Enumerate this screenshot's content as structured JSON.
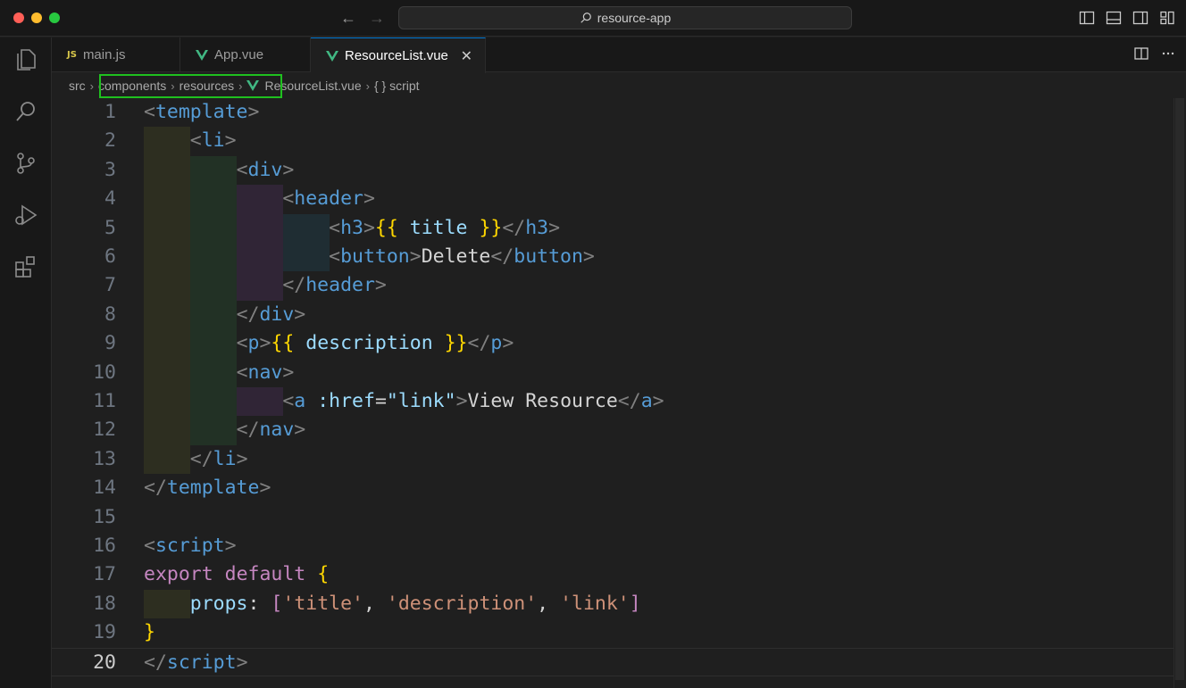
{
  "window": {
    "search_text": "resource-app"
  },
  "tabs": [
    {
      "badge": "JS",
      "label": "main.js",
      "icon": "js-file-icon"
    },
    {
      "label": "App.vue",
      "icon": "vue-file-icon"
    },
    {
      "label": "ResourceList.vue",
      "icon": "vue-file-icon",
      "active": true,
      "close": "✕"
    }
  ],
  "breadcrumb": {
    "items": [
      "src",
      "components",
      "resources",
      "ResourceList.vue",
      "{ } script"
    ]
  },
  "editor": {
    "current_line": 20,
    "line_numbers": [
      "1",
      "2",
      "3",
      "4",
      "5",
      "6",
      "7",
      "8",
      "9",
      "10",
      "11",
      "12",
      "13",
      "14",
      "15",
      "16",
      "17",
      "18",
      "19",
      "20"
    ]
  },
  "colors": {
    "tag": "#569cd6",
    "bracket_gold": "#ffd700",
    "string": "#ce9178",
    "keyword": "#c586c0",
    "variable": "#9cdcfe",
    "highlight_box": "#1fc01f"
  }
}
